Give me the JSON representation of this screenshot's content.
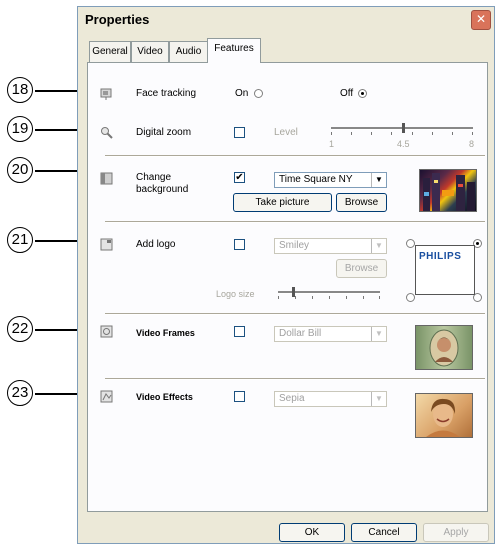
{
  "window": {
    "title": "Properties",
    "close_glyph": "✕"
  },
  "tabs": [
    {
      "label": "General",
      "active": false
    },
    {
      "label": "Video",
      "active": false
    },
    {
      "label": "Audio",
      "active": false
    },
    {
      "label": "Features",
      "active": true
    }
  ],
  "callouts": [
    "18",
    "19",
    "20",
    "21",
    "22",
    "23"
  ],
  "face_tracking": {
    "label": "Face tracking",
    "on_label": "On",
    "off_label": "Off",
    "selected": "Off",
    "icon": "face-tracking-icon"
  },
  "digital_zoom": {
    "label": "Digital zoom",
    "checked": false,
    "level_label": "Level",
    "tick_min": "1",
    "tick_mid": "4.5",
    "tick_max": "8",
    "level": 4.5,
    "icon": "zoom-icon"
  },
  "change_background": {
    "label": "Change background",
    "checked": true,
    "selected": "Time Square NY",
    "take_picture_label": "Take picture",
    "browse_label": "Browse",
    "icon": "background-icon"
  },
  "add_logo": {
    "label": "Add logo",
    "checked": false,
    "selected": "Smiley",
    "browse_label": "Browse",
    "logo_size_label": "Logo size",
    "logo_text": "PHILIPS",
    "icon": "logo-icon",
    "logo_position": "top-right"
  },
  "video_frames": {
    "label": "Video Frames",
    "checked": false,
    "selected": "Dollar Bill",
    "icon": "frames-icon"
  },
  "video_effects": {
    "label": "Video Effects",
    "checked": false,
    "selected": "Sepia",
    "icon": "effects-icon"
  },
  "buttons": {
    "ok": "OK",
    "cancel": "Cancel",
    "apply": "Apply"
  }
}
